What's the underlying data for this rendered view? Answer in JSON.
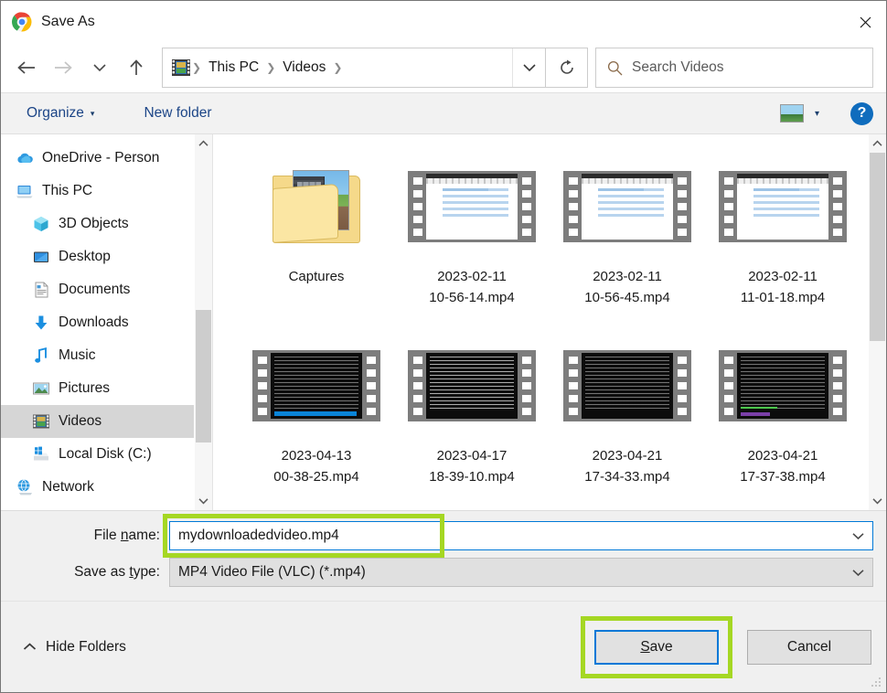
{
  "window": {
    "title": "Save As",
    "app_icon": "chrome-logo-icon",
    "close_label": "✕"
  },
  "nav": {
    "back_icon": "←",
    "forward_icon": "→",
    "recent_icon": "⌄",
    "up_icon": "↑",
    "refresh_icon": "↻",
    "breadcrumb_dropdown_icon": "⌄",
    "breadcrumb": [
      {
        "label": "This PC"
      },
      {
        "label": "Videos"
      }
    ],
    "breadcrumb_separator": "❯",
    "folder_icon": "videos-folder-icon"
  },
  "search": {
    "placeholder": "Search Videos",
    "icon": "search-icon"
  },
  "toolbar": {
    "organize_label": "Organize",
    "organize_caret": "▾",
    "new_folder_label": "New folder",
    "view_icon": "view-layout-icon",
    "view_caret": "▾",
    "help_label": "?"
  },
  "sidebar": {
    "items": [
      {
        "label": "OneDrive - Person",
        "icon": "onedrive-cloud-icon",
        "selected": false,
        "root": true
      },
      {
        "label": "This PC",
        "icon": "this-pc-icon",
        "selected": false,
        "root": true
      },
      {
        "label": "3D Objects",
        "icon": "3d-objects-icon",
        "selected": false,
        "root": false
      },
      {
        "label": "Desktop",
        "icon": "desktop-icon",
        "selected": false,
        "root": false
      },
      {
        "label": "Documents",
        "icon": "documents-icon",
        "selected": false,
        "root": false
      },
      {
        "label": "Downloads",
        "icon": "downloads-arrow-icon",
        "selected": false,
        "root": false
      },
      {
        "label": "Music",
        "icon": "music-note-icon",
        "selected": false,
        "root": false
      },
      {
        "label": "Pictures",
        "icon": "pictures-icon",
        "selected": false,
        "root": false
      },
      {
        "label": "Videos",
        "icon": "videos-filmstrip-icon",
        "selected": true,
        "root": false
      },
      {
        "label": "Local Disk (C:)",
        "icon": "local-disk-icon",
        "selected": false,
        "root": false
      },
      {
        "label": "Network",
        "icon": "network-globe-icon",
        "selected": false,
        "root": true
      }
    ]
  },
  "files": {
    "items": [
      {
        "name": "Captures",
        "kind": "folder",
        "thumb": "minecraft-screenshot-folder"
      },
      {
        "name": "2023-02-11 10-56-14.mp4",
        "line1": "2023-02-11",
        "line2": "10-56-14.mp4",
        "kind": "video",
        "thumb": "spreadsheet-light"
      },
      {
        "name": "2023-02-11 10-56-45.mp4",
        "line1": "2023-02-11",
        "line2": "10-56-45.mp4",
        "kind": "video",
        "thumb": "spreadsheet-light"
      },
      {
        "name": "2023-02-11 11-01-18.mp4",
        "line1": "2023-02-11",
        "line2": "11-01-18.mp4",
        "kind": "video",
        "thumb": "spreadsheet-light"
      },
      {
        "name": "2023-04-13 00-38-25.mp4",
        "line1": "2023-04-13",
        "line2": "00-38-25.mp4",
        "kind": "video",
        "thumb": "terminal-dark-bluebar"
      },
      {
        "name": "2023-04-17 18-39-10.mp4",
        "line1": "2023-04-17",
        "line2": "18-39-10.mp4",
        "kind": "video",
        "thumb": "terminal-dark-noise"
      },
      {
        "name": "2023-04-21 17-34-33.mp4",
        "line1": "2023-04-21",
        "line2": "17-34-33.mp4",
        "kind": "video",
        "thumb": "terminal-dark"
      },
      {
        "name": "2023-04-21 17-37-38.mp4",
        "line1": "2023-04-21",
        "line2": "17-37-38.mp4",
        "kind": "video",
        "thumb": "terminal-dark-purple"
      }
    ]
  },
  "form": {
    "file_name_label_pre": "File ",
    "file_name_label_mnemonic": "n",
    "file_name_label_post": "ame:",
    "file_name_value": "mydownloadedvideo.mp4",
    "save_type_label_pre": "Save as ",
    "save_type_label_mnemonic": "t",
    "save_type_label_post": "ype:",
    "save_type_value": "MP4 Video File (VLC) (*.mp4)",
    "dropdown_icon": "⌄"
  },
  "footer": {
    "hide_folders_label": "Hide Folders",
    "hide_folders_icon": "⌃",
    "save_label_mnemonic": "S",
    "save_label_rest": "ave",
    "cancel_label": "Cancel"
  },
  "colors": {
    "highlight_green": "#a5d723",
    "focus_blue": "#0078d7",
    "selection_grey": "#d6d6d6",
    "toolbar_link": "#1c4587",
    "help_blue": "#0f6cbd"
  }
}
